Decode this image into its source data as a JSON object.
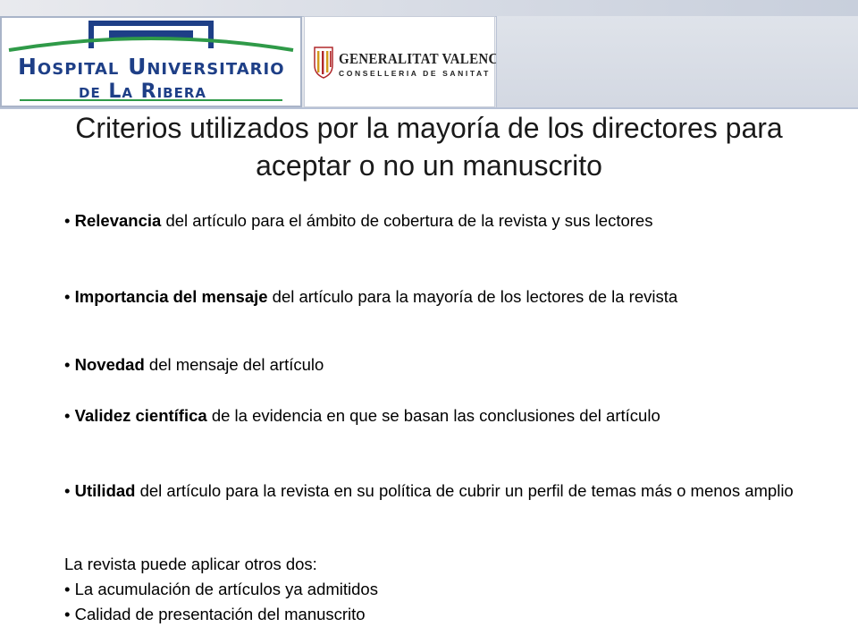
{
  "header": {
    "hospital_logo": {
      "line1": "Hospital Universitario",
      "line2": "de La Ribera"
    },
    "gva_logo": {
      "line1": "GENERALITAT VALENCIANA",
      "line2": "CONSELLERIA DE SANITAT"
    }
  },
  "slide": {
    "title": "Criterios utilizados por la mayoría de los directores para aceptar o no un manuscrito",
    "bullet_symbol": "•",
    "criteria": [
      {
        "term": "Relevancia",
        "text": " del artículo para el ámbito de cobertura de la revista y sus lectores"
      },
      {
        "term": "Importancia del mensaje",
        "text": " del artículo para la mayoría de los lectores de la revista"
      },
      {
        "term": "Novedad",
        "text": " del mensaje del artículo"
      },
      {
        "term": "Validez científica",
        "text": " de la evidencia en que se basan las conclusiones del artículo"
      },
      {
        "term": "Utilidad",
        "text": " del artículo para la revista en su política de cubrir un perfil de temas más o menos amplio"
      }
    ],
    "extra_intro": "La revista puede aplicar otros dos:",
    "extra_items": [
      "La acumulación de artículos ya admitidos",
      "Calidad de presentación del manuscrito"
    ]
  },
  "colors": {
    "logo_blue": "#1e3f87",
    "logo_green": "#2f9a48",
    "header_border": "#a9b4c8"
  }
}
